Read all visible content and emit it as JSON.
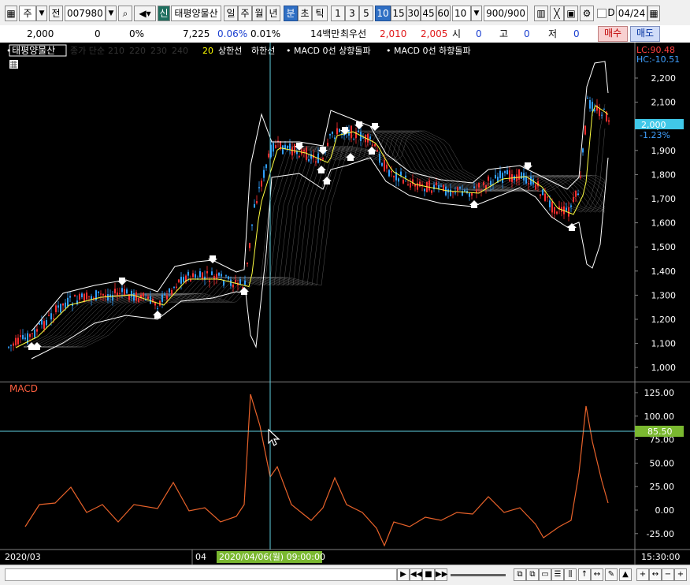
{
  "toolbar": {
    "period_unit": "주",
    "prev_label": "전",
    "code": "007980",
    "stock_name": "태평양물산",
    "new_badge": "신",
    "periods": [
      "일",
      "주",
      "월",
      "년",
      "분",
      "초",
      "틱"
    ],
    "active_period": "분",
    "intervals": [
      "1",
      "3",
      "5",
      "10",
      "15",
      "30",
      "45",
      "60"
    ],
    "active_interval": "10",
    "interval_select": "10",
    "count": "900",
    "count_total": "/900",
    "d_label": "D",
    "date": "04/24"
  },
  "info": {
    "price": "2,000",
    "change": "0",
    "change_pct": "0%",
    "volume": "7,225",
    "vol_pct1": "0.06%",
    "vol_pct2": "0.01%",
    "amount": "14백만",
    "best_label": "최우선",
    "best_ask": "2,010",
    "best_bid": "2,005",
    "open_label": "시",
    "open_value": "0",
    "high_label": "고",
    "high_value": "0",
    "low_label": "저",
    "low_value": "0",
    "buy_label": "매수",
    "sell_label": "매도"
  },
  "legend": {
    "name": "태평양물산",
    "ma_label": "종가 단순",
    "ma_periods": [
      "210",
      "220",
      "230",
      "240"
    ],
    "period20": "20",
    "upper": "상한선",
    "lower": "하한선",
    "macd_up": "MACD 0선 상향돌파",
    "macd_down": "MACD 0선 하향돌파"
  },
  "price_axis": [
    "2,200",
    "2,100",
    "2,000",
    "1,900",
    "1,800",
    "1,700",
    "1,600",
    "1,500",
    "1,400",
    "1,300",
    "1,200",
    "1,100",
    "1,000"
  ],
  "price_badge": {
    "lc": "LC:90.48",
    "hc": "HC:-10.51",
    "current": "2,000",
    "pct": "-1.23%"
  },
  "macd": {
    "label": "MACD",
    "axis": [
      "125.00",
      "100.00",
      "75.00",
      "50.00",
      "25.00",
      "0.00",
      "-25.00"
    ],
    "crosshair_value": "85.50"
  },
  "time_axis": {
    "left": "2020/03",
    "tick": "04",
    "crosshair": "2020/04/06(월) 09:00:00",
    "right": "15:30:00"
  },
  "colors": {
    "background": "#000000",
    "macd_line": "#e8622a",
    "crosshair": "#5fd0e0",
    "band": "#ffffff",
    "accent": "#2f6fc4"
  }
}
